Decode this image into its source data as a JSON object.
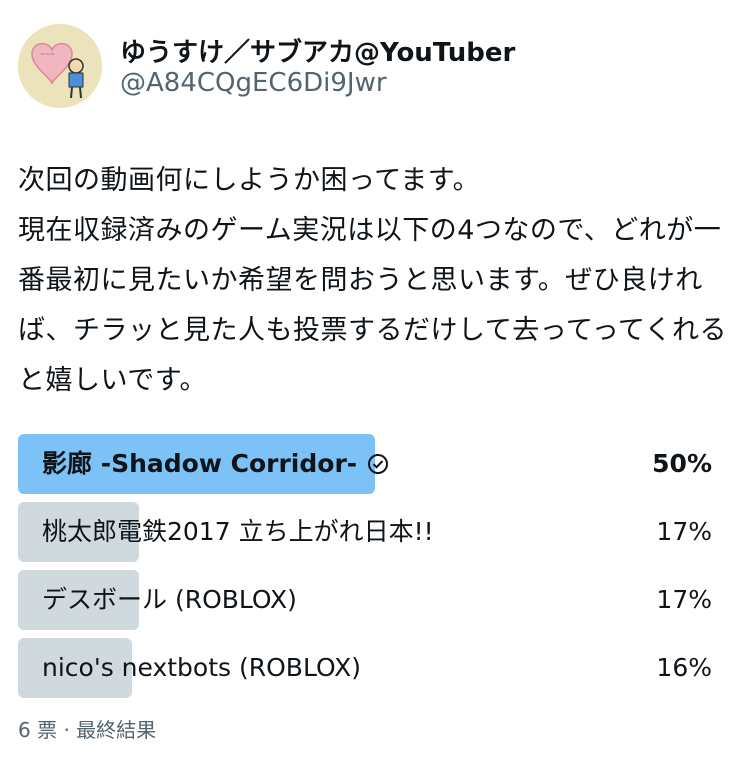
{
  "author": {
    "name": "ゆうすけ／サブアカ@YouTuber",
    "handle": "@A84CQgEC6Di9Jwr",
    "avatar_icon": "avatar-drawing-icon"
  },
  "tweet_text": "次回の動画何にしようか困ってます。\n現在収録済みのゲーム実況は以下の4つなので、どれが一番最初に見たいか希望を問おうと思います。ぜひ良ければ、チラッと見た人も投票するだけして去ってってくれると嬉しいです。",
  "poll": {
    "options": [
      {
        "label": "影廊 -Shadow Corridor-",
        "percent": "50%",
        "fraction": 0.5,
        "selected": true
      },
      {
        "label": "桃太郎電鉄2017 立ち上がれ日本!!",
        "percent": "17%",
        "fraction": 0.17,
        "selected": false
      },
      {
        "label": "デスボール (ROBLOX)",
        "percent": "17%",
        "fraction": 0.17,
        "selected": false
      },
      {
        "label": "nico's nextbots (ROBLOX)",
        "percent": "16%",
        "fraction": 0.16,
        "selected": false
      }
    ],
    "meta": "6 票 · 最終結果",
    "colors": {
      "winner": "#7cc2f7",
      "other": "#cfd9de"
    }
  }
}
